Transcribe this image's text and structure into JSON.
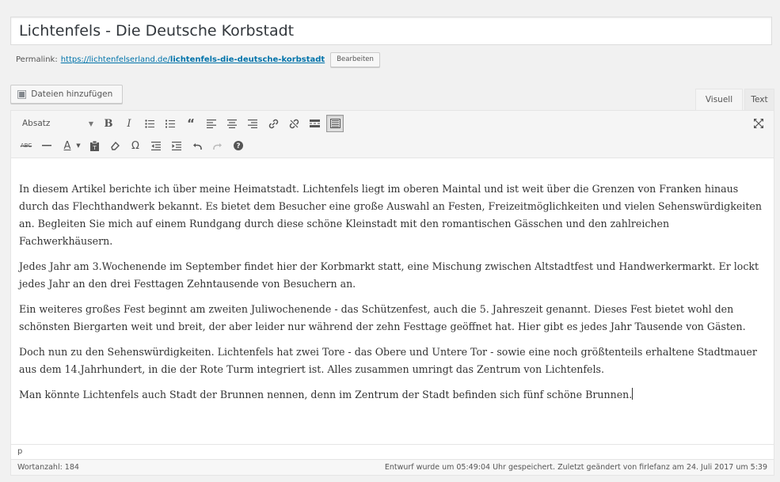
{
  "post": {
    "title": "Lichtenfels - Die Deutsche Korbstadt"
  },
  "permalink": {
    "label": "Permalink:",
    "url_base": "https://lichtenfelserland.de/",
    "url_slug": "lichtenfels-die-deutsche-korbstadt",
    "edit_label": "Bearbeiten"
  },
  "media": {
    "add_label": "Dateien hinzufügen"
  },
  "tabs": {
    "visual": "Visuell",
    "text": "Text"
  },
  "toolbar": {
    "format_value": "Absatz",
    "row1_icons": [
      "bold",
      "italic",
      "bulleted-list",
      "numbered-list",
      "blockquote",
      "align-left",
      "align-center",
      "align-right",
      "insert-link",
      "remove-link",
      "insert-more-tag",
      "toolbar-toggle"
    ],
    "row2_icons": [
      "strikethrough",
      "horizontal-line",
      "text-color",
      "paste-as-text",
      "clear-formatting",
      "special-character",
      "outdent",
      "indent",
      "undo",
      "redo",
      "keyboard-shortcuts"
    ]
  },
  "content": {
    "paragraphs": [
      "In diesem Artikel berichte ich über meine Heimatstadt. Lichtenfels liegt im  oberen Maintal und ist weit über die Grenzen von Franken hinaus durch das Flechthandwerk bekannt. Es bietet dem Besucher eine  große Auswahl an Festen, Freizeitmöglichkeiten und vielen Sehenswürdigkeiten an. Begleiten Sie mich auf einem Rundgang durch diese schöne Kleinstadt mit den romantischen Gässchen und den zahlreichen Fachwerkhäusern.",
      "Jedes Jahr am 3.Wochenende im September findet hier der Korbmarkt statt, eine Mischung zwischen Altstadtfest und Handwerkermarkt. Er lockt jedes Jahr an den drei Festtagen Zehntausende von Besuchern an.",
      "Ein weiteres großes Fest beginnt am zweiten Juliwochenende - das Schützenfest, auch die 5. Jahreszeit genannt. Dieses Fest bietet wohl den schönsten Biergarten weit und breit, der aber leider nur während der zehn Festtage geöffnet hat. Hier gibt es jedes Jahr Tausende von Gästen.",
      "Doch nun zu den Sehenswürdigkeiten. Lichtenfels hat zwei Tore - das Obere und Untere Tor - sowie eine noch größtenteils erhaltene Stadtmauer aus dem 14.Jahrhundert,  in die der Rote Turm integriert ist. Alles zusammen umringt das Zentrum von Lichtenfels.",
      "Man könnte Lichtenfels auch Stadt der Brunnen nennen, denn im Zentrum der Stadt befinden sich fünf schöne Brunnen."
    ]
  },
  "path": "p",
  "status": {
    "word_count": "Wortanzahl: 184",
    "save_info": "Entwurf wurde um 05:49:04 Uhr gespeichert. Zuletzt geändert von firlefanz am 24. Juli 2017 um 5:39"
  }
}
